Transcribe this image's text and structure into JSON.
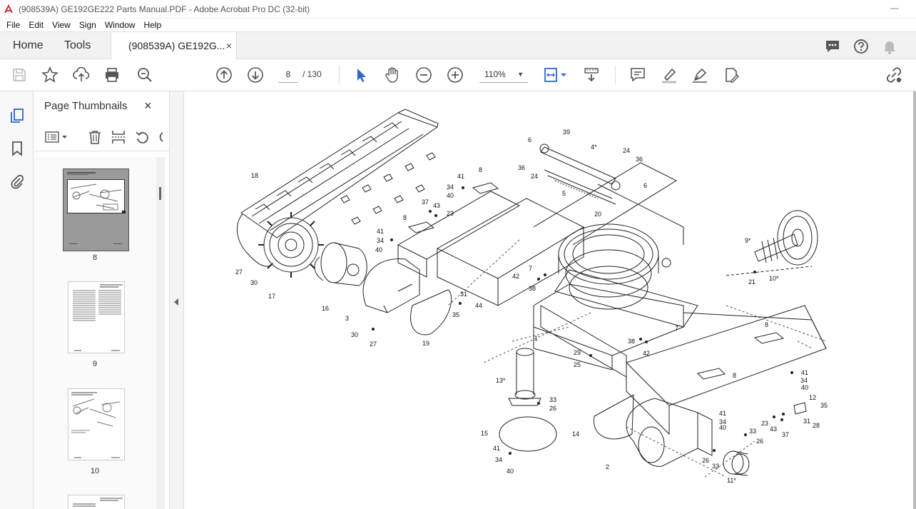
{
  "window": {
    "title": "(908539A) GE192GE222 Parts Manual.PDF - Adobe Acrobat Pro DC (32-bit)",
    "minimize": "—"
  },
  "menu": [
    "File",
    "Edit",
    "View",
    "Sign",
    "Window",
    "Help"
  ],
  "tabs": {
    "home": "Home",
    "tools": "Tools",
    "document": "(908539A) GE192G...",
    "close": "×"
  },
  "toolbar": {
    "current_page": "8",
    "total_pages": "/ 130",
    "zoom": "110%",
    "icons": [
      "save-icon",
      "star-icon",
      "upload-icon",
      "print-icon",
      "zoom-search-icon",
      "page-up-icon",
      "page-down-icon",
      "select-arrow-icon",
      "hand-icon",
      "zoom-out-icon",
      "zoom-in-icon",
      "fit-page-icon",
      "scroll-mode-icon",
      "comment-icon",
      "highlight-icon",
      "sign-icon",
      "edit-icon",
      "share-link-icon"
    ]
  },
  "panel": {
    "title": "Page Thumbnails",
    "close": "×",
    "thumbnails": [
      {
        "label": "8"
      },
      {
        "label": "9"
      },
      {
        "label": "10"
      }
    ]
  },
  "colors": {
    "acrobat_red": "#d7191c",
    "accent_blue": "#2e68c6",
    "icon_gray": "#555555"
  },
  "diagram_labels": [
    "18",
    "27",
    "30",
    "17",
    "16",
    "3",
    "30",
    "27",
    "19",
    "31",
    "35",
    "44",
    "41",
    "34",
    "40",
    "8",
    "37",
    "43",
    "23",
    "8",
    "41",
    "34",
    "40",
    "6",
    "36",
    "24",
    "39",
    "4*",
    "24",
    "36",
    "6",
    "5",
    "20",
    "7",
    "42",
    "38",
    "1",
    "29",
    "25",
    "13*",
    "33",
    "26",
    "15",
    "41",
    "34",
    "40",
    "14",
    "2",
    "26",
    "33",
    "11*",
    "38",
    "42",
    "7",
    "8",
    "8",
    "41",
    "34",
    "40",
    "12",
    "35",
    "31",
    "28",
    "23",
    "43",
    "37",
    "33",
    "26",
    "41",
    "34",
    "40",
    "9*",
    "21",
    "10*"
  ]
}
